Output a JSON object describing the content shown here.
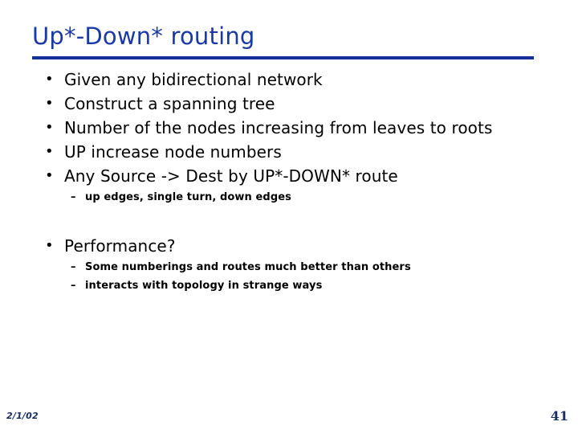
{
  "slide": {
    "title": "Up*-Down* routing",
    "title_color": "#1939a8",
    "rule_color": "#152f9b",
    "background_color": "#ffffff",
    "body_text_color": "#000000"
  },
  "bullets": [
    {
      "level": 1,
      "marker": "•",
      "text": "Given any bidirectional network"
    },
    {
      "level": 1,
      "marker": "•",
      "text": "Construct a spanning tree"
    },
    {
      "level": 1,
      "marker": "•",
      "text": "Number of the nodes increasing from leaves to roots"
    },
    {
      "level": 1,
      "marker": "•",
      "text": "UP increase node numbers"
    },
    {
      "level": 1,
      "marker": "•",
      "text": "Any Source -> Dest by UP*-DOWN* route"
    },
    {
      "level": 2,
      "marker": "–",
      "text": "up edges, single turn, down edges"
    },
    {
      "level": 1,
      "marker": "•",
      "text": "Performance?"
    },
    {
      "level": 2,
      "marker": "–",
      "text": "Some numberings and routes much better than others"
    },
    {
      "level": 2,
      "marker": "–",
      "text": "interacts with topology in strange ways"
    }
  ],
  "footer": {
    "date": "2/1/02",
    "slide_number": "41",
    "color": "#16306b"
  }
}
